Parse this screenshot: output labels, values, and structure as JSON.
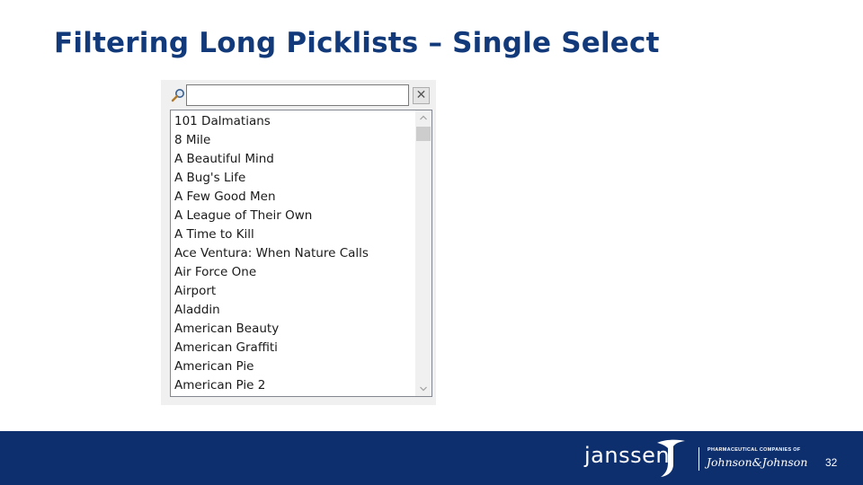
{
  "slide": {
    "title": "Filtering Long Picklists – Single Select",
    "page_number": "32"
  },
  "picklist": {
    "search_value": "",
    "search_icon": "search-icon",
    "clear_icon": "close-icon",
    "clear_label": "✕",
    "items": [
      "101 Dalmatians",
      "8 Mile",
      "A Beautiful Mind",
      "A Bug's Life",
      "A Few Good Men",
      "A League of Their Own",
      "A Time to Kill",
      "Ace Ventura: When Nature Calls",
      "Air Force One",
      "Airport",
      "Aladdin",
      "American Beauty",
      "American Graffiti",
      "American Pie",
      "American Pie 2"
    ],
    "scroll_up_glyph": "^",
    "scroll_down_glyph": "v"
  },
  "footer": {
    "brand": "janssen",
    "tagline": "PHARMACEUTICAL COMPANIES OF",
    "parent_brand": "Johnson&Johnson",
    "background_color": "#0d2f6e"
  },
  "colors": {
    "title": "#123a7a",
    "footer": "#0d2f6e"
  }
}
